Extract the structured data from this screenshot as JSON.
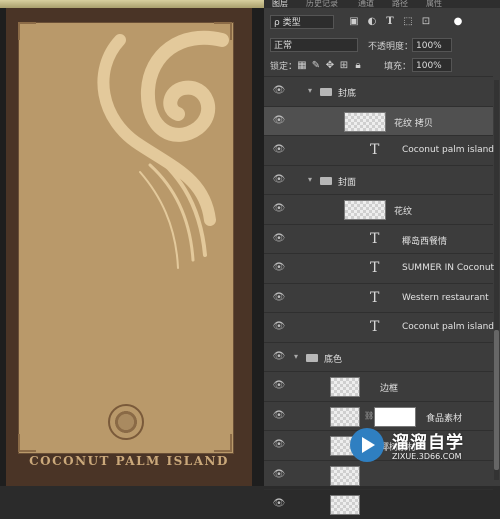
{
  "document": {
    "footer_title": "COCONUT PALM ISLAND"
  },
  "panel_tabs": [
    "图层",
    "历史记录",
    "通道",
    "路径",
    "属性"
  ],
  "filter": {
    "kind_label": "ρ 类型"
  },
  "blend": {
    "mode": "正常",
    "opacity_label": "不透明度：",
    "opacity": "100%"
  },
  "lock": {
    "label": "锁定：",
    "fill_label": "填充：",
    "fill": "100%"
  },
  "layers": [
    {
      "type": "group",
      "name": "封底",
      "indent": 1
    },
    {
      "type": "image",
      "name": "花纹 拷贝",
      "indent": 2,
      "selected": true
    },
    {
      "type": "text",
      "name": "Coconut palm island",
      "indent": 2
    },
    {
      "type": "group",
      "name": "封面",
      "indent": 1
    },
    {
      "type": "image",
      "name": "花纹",
      "indent": 2
    },
    {
      "type": "text",
      "name": "椰岛西餐情",
      "indent": 2
    },
    {
      "type": "text",
      "name": "SUMMER IN Coconut ...",
      "indent": 2
    },
    {
      "type": "text",
      "name": "Western restaurant",
      "indent": 2
    },
    {
      "type": "text",
      "name": "Coconut palm island",
      "indent": 2
    },
    {
      "type": "group",
      "name": "底色",
      "indent": 0
    },
    {
      "type": "image",
      "name": "边框",
      "indent": 1
    },
    {
      "type": "image-mask",
      "name": "食品素材",
      "indent": 1
    },
    {
      "type": "image",
      "name": "椰树素材",
      "indent": 1
    },
    {
      "type": "image",
      "name": "",
      "indent": 1
    },
    {
      "type": "image",
      "name": "",
      "indent": 1
    }
  ],
  "watermark": {
    "title": "溜溜自学",
    "url": "ZIXUE.3D66.COM"
  }
}
